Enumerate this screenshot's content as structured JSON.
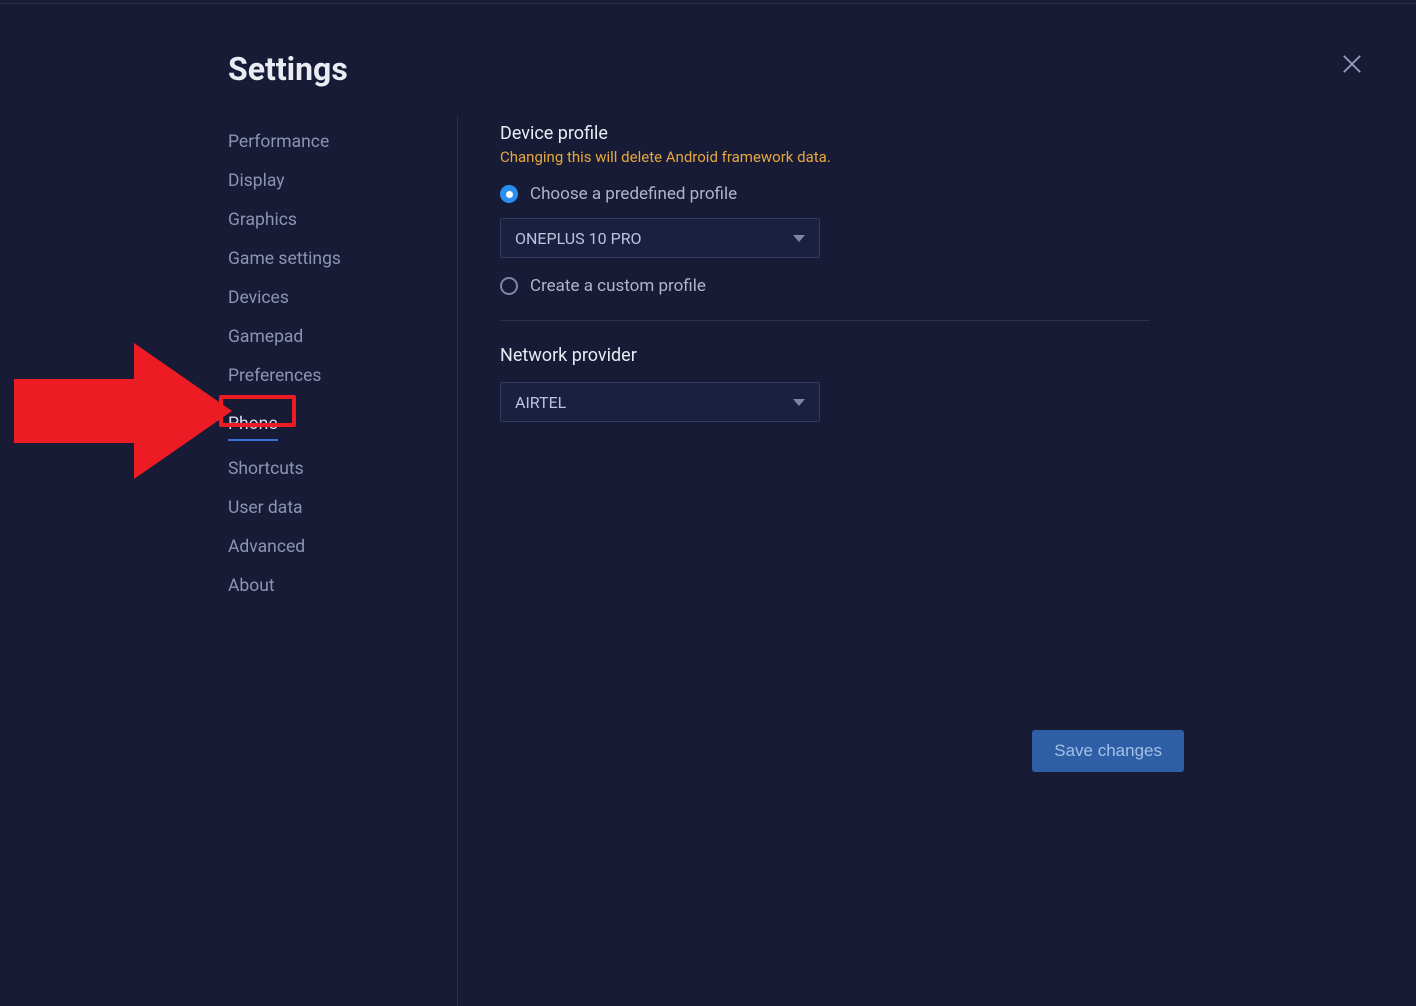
{
  "header": {
    "title": "Settings"
  },
  "sidebar": {
    "items": [
      {
        "label": "Performance"
      },
      {
        "label": "Display"
      },
      {
        "label": "Graphics"
      },
      {
        "label": "Game settings"
      },
      {
        "label": "Devices"
      },
      {
        "label": "Gamepad"
      },
      {
        "label": "Preferences"
      },
      {
        "label": "Phone"
      },
      {
        "label": "Shortcuts"
      },
      {
        "label": "User data"
      },
      {
        "label": "Advanced"
      },
      {
        "label": "About"
      }
    ],
    "active_index": 7
  },
  "main": {
    "device_profile": {
      "title": "Device profile",
      "warning": "Changing this will delete Android framework data.",
      "option_predefined": "Choose a predefined profile",
      "predefined_value": "ONEPLUS 10 PRO",
      "option_custom": "Create a custom profile"
    },
    "network_provider": {
      "title": "Network provider",
      "value": "AIRTEL"
    }
  },
  "footer": {
    "save_label": "Save changes"
  }
}
